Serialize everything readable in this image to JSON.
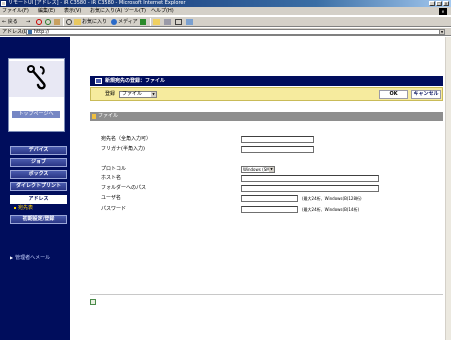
{
  "window": {
    "title": "リモートUI [アドレス] - iR C3580 - iR C3580 - Microsoft Internet Explorer",
    "buttons": {
      "minimize": "_",
      "maximize": "□",
      "close": "×"
    }
  },
  "menu": {
    "items": [
      "ファイル(F)",
      "編集(E)",
      "表示(V)",
      "お気に入り(A)",
      "ツール(T)",
      "ヘルプ(H)"
    ]
  },
  "toolbar": {
    "back": "← 戻る",
    "forward": "→",
    "favorites_label": "お気に入り",
    "media_label": "メディア"
  },
  "address": {
    "label": "アドレス(D)",
    "url": "http://"
  },
  "sidebar": {
    "logo_caption": "トップページへ",
    "buttons": [
      {
        "label": "デバイス"
      },
      {
        "label": "ジョブ"
      },
      {
        "label": "ボックス"
      },
      {
        "label": "ダイレクトプリント"
      },
      {
        "label": "アドレス"
      }
    ],
    "sub_items": [
      "宛先表",
      "初期設定/登録"
    ],
    "link": "管理者へメール"
  },
  "main": {
    "title": "新規宛先の登録：ファイル",
    "registration_label": "登録",
    "registration_value": "ファイル",
    "ok_label": "OK",
    "cancel_label": "キャンセル",
    "section_title": "ファイル",
    "fields": {
      "name_label": "宛先名（全角入力可）",
      "furigana_label": "フリガナ(半角入力)",
      "protocol_label": "プロトコル",
      "protocol_value": "Windows (SMB)",
      "hostname_label": "ホスト名",
      "folder_label": "フォルダーへのパス",
      "username_label": "ユーザ名",
      "password_label": "パスワード",
      "username_hint": "(最大24桁、Windows(B)128桁)",
      "password_hint": "(最大24桁、Windows(B)14桁)"
    }
  }
}
